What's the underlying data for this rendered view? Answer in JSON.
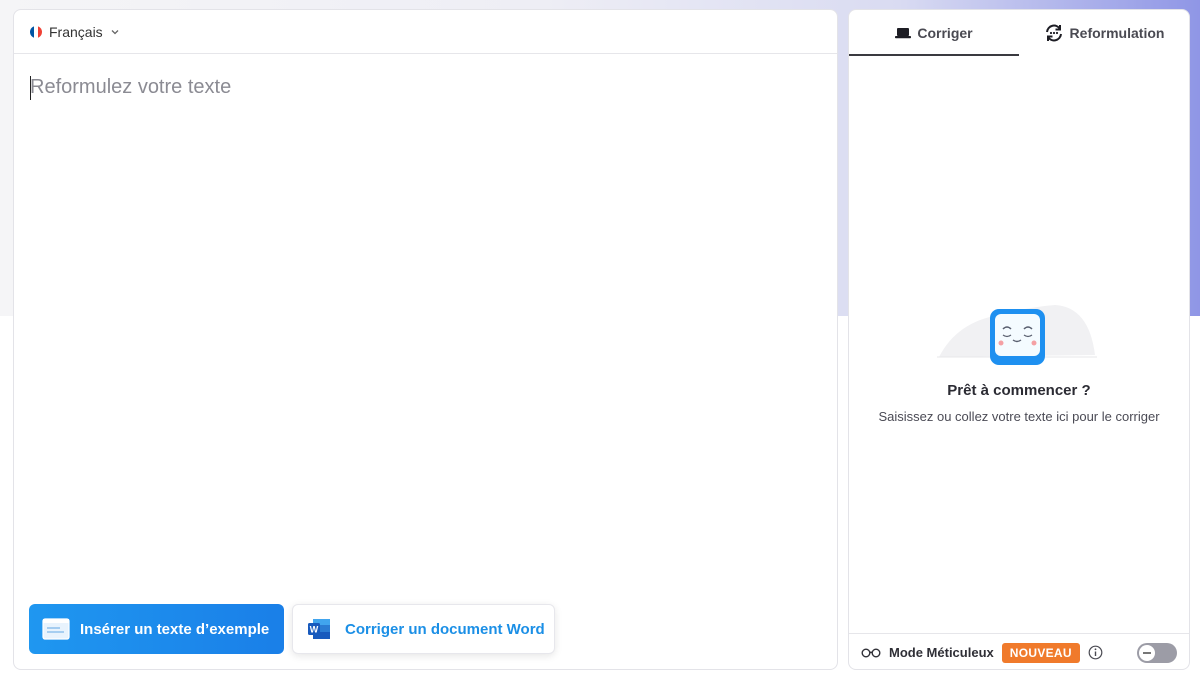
{
  "language": {
    "label": "Français",
    "flag_colors": [
      "#0055a4",
      "#ffffff",
      "#ef4135"
    ]
  },
  "editor": {
    "placeholder": "Reformulez votre texte"
  },
  "actions": {
    "insert_example_label": "Insérer un texte d’exemple",
    "correct_word_label": "Corriger un document Word"
  },
  "tabs": [
    {
      "label": "Corriger",
      "icon": "laptop-icon",
      "active": true
    },
    {
      "label": "Reformulation",
      "icon": "rephrase-icon",
      "active": false
    }
  ],
  "empty_state": {
    "title": "Prêt à commencer ?",
    "subtitle": "Saisissez ou collez votre texte ici pour le corriger"
  },
  "footer": {
    "mode_label": "Mode Méticuleux",
    "badge": "NOUVEAU",
    "toggle_on": false
  },
  "colors": {
    "primary": "#1a8be8",
    "badge": "#f07a2b",
    "accent_bg": "#8f96e6"
  }
}
